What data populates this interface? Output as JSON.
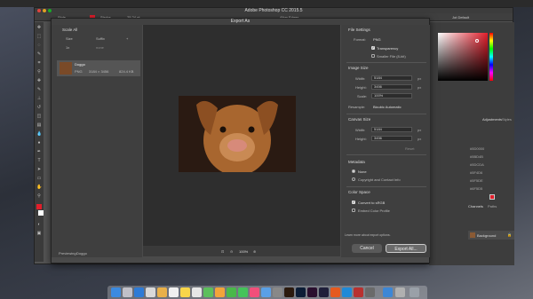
{
  "window": {
    "title": "Adobe Photoshop CC 2015.5"
  },
  "options_bar": {
    "style_label": "Style",
    "stroke_label": "Stroke",
    "stroke_value": "25.24 pt",
    "align_label": "Align Edges",
    "panel_label": "Jot Default"
  },
  "dialog": {
    "title": "Export As",
    "scale_all": "Scale All",
    "size_col": "Size",
    "suffix_col": "Suffix",
    "size_value": "1x",
    "suffix_placeholder": "none",
    "asset": {
      "name": "Doggo",
      "format": "PNG",
      "dims": "3184 × 3456",
      "filesize": "824.4 KB"
    },
    "previewing_label": "Previewing:",
    "previewing_value": "Doggo",
    "zoom_value": "100%",
    "file_settings": {
      "header": "File Settings",
      "format_label": "Format:",
      "format_value": "PNG",
      "transparency": "Transparency",
      "smaller_file": "Smaller File (8-bit)"
    },
    "image_size": {
      "header": "Image Size",
      "width_label": "Width:",
      "width_value": "5184",
      "height_label": "Height:",
      "height_value": "3456",
      "scale_label": "Scale:",
      "scale_value": "100%",
      "resample_label": "Resample:",
      "resample_value": "Bicubic Automatic",
      "unit": "px"
    },
    "canvas_size": {
      "header": "Canvas Size",
      "width_label": "Width:",
      "width_value": "5184",
      "height_label": "Height:",
      "height_value": "3456",
      "reset": "Reset",
      "unit": "px"
    },
    "metadata": {
      "header": "Metadata",
      "none": "None",
      "copyright": "Copyright and Contact Info"
    },
    "color_space": {
      "header": "Color Space",
      "convert": "Convert to sRGB",
      "embed": "Embed Color Profile"
    },
    "learn_more": "Learn more about export options.",
    "cancel": "Cancel",
    "export": "Export All..."
  },
  "right_panel": {
    "adjustments_tab": "Adjustments",
    "styles_tab": "Styles",
    "channels_tab": "Channels",
    "paths_tab": "Paths",
    "layer_name": "Background",
    "hex_codes": [
      "#5D0000",
      "#5BD4B",
      "#5DCDA",
      "#5F4D6",
      "#5F5DE",
      "#6F5D5"
    ],
    "accent_color": "#e21e2b"
  }
}
